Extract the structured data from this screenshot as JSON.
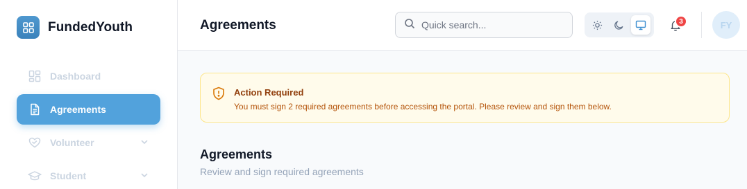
{
  "brand": {
    "name": "FundedYouth"
  },
  "sidebar": {
    "items": [
      {
        "label": "Dashboard",
        "icon": "dashboard-grid-icon"
      },
      {
        "label": "Agreements",
        "icon": "document-icon",
        "active": true
      },
      {
        "label": "Volunteer",
        "icon": "heart-hand-icon",
        "has_submenu": true
      },
      {
        "label": "Student",
        "icon": "graduation-cap-icon",
        "has_submenu": true
      }
    ]
  },
  "header": {
    "title": "Agreements",
    "search": {
      "placeholder": "Quick search...",
      "value": ""
    },
    "theme": {
      "options": [
        "light",
        "dark",
        "system"
      ],
      "selected": "system"
    },
    "notifications": {
      "count": "3"
    },
    "avatar": {
      "initials": "FY"
    }
  },
  "alert": {
    "title": "Action Required",
    "message": "You must sign 2 required agreements before accessing the portal. Please review and sign them below."
  },
  "section": {
    "title": "Agreements",
    "subtitle": "Review and sign required agreements"
  },
  "colors": {
    "accent": "#52a2dc",
    "warning_bg": "#fffbeb",
    "warning_text": "#92400e",
    "badge": "#ef4444"
  }
}
